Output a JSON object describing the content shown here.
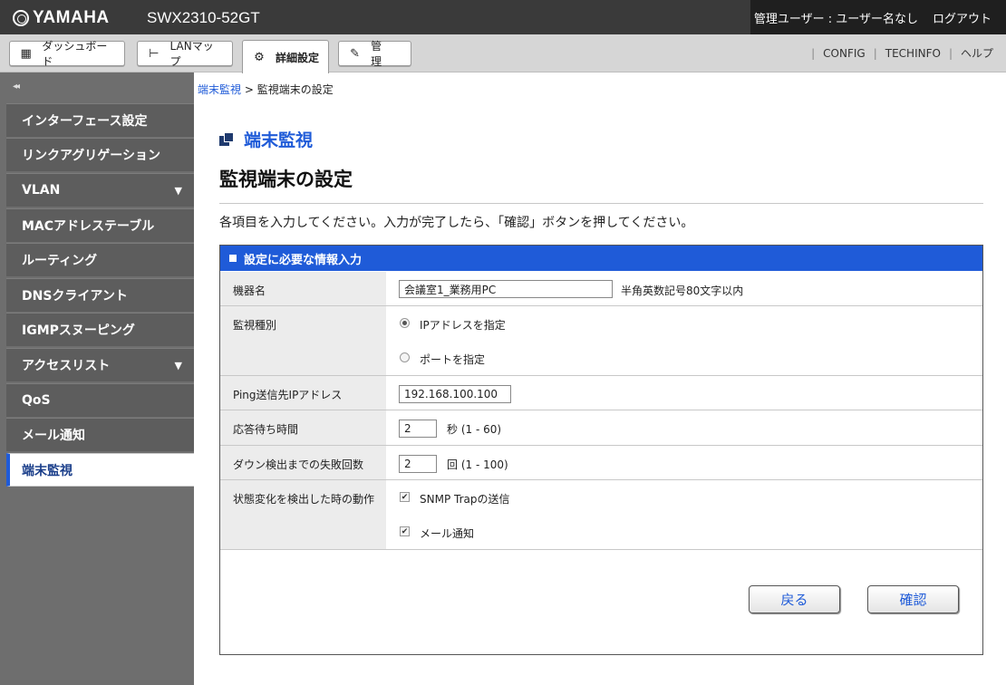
{
  "header": {
    "brand": "YAMAHA",
    "model": "SWX2310-52GT",
    "user_status": "管理ユーザー : ユーザー名なし",
    "logout": "ログアウト"
  },
  "tabs": [
    {
      "label": "ダッシュボード",
      "icon": "dashboard-icon"
    },
    {
      "label": "LANマップ",
      "icon": "lan-map-icon"
    },
    {
      "label": "詳細設定",
      "icon": "gear-icon",
      "active": true
    },
    {
      "label": "管　理",
      "icon": "wrench-icon"
    }
  ],
  "toplinks": [
    "CONFIG",
    "TECHINFO",
    "ヘルプ"
  ],
  "sidebar": {
    "collapse": "◂◂",
    "items": [
      {
        "label": "インターフェース設定"
      },
      {
        "label": "リンクアグリゲーション"
      },
      {
        "label": "VLAN",
        "arrow": "▼"
      },
      {
        "label": "MACアドレステーブル"
      },
      {
        "label": "ルーティング"
      },
      {
        "label": "DNSクライアント"
      },
      {
        "label": "IGMPスヌーピング"
      },
      {
        "label": "アクセスリスト",
        "arrow": "▼"
      },
      {
        "label": "QoS"
      },
      {
        "label": "メール通知"
      },
      {
        "label": "端末監視",
        "active": true
      }
    ]
  },
  "breadcrumb": {
    "link": "端末監視",
    "separator": " > ",
    "current": "監視端末の設定"
  },
  "section_title": "端末監視",
  "page_title": "監視端末の設定",
  "instruction": "各項目を入力してください。入力が完了したら、「確認」ボタンを押してください。",
  "form": {
    "header": "設定に必要な情報入力",
    "device_name": {
      "label": "機器名",
      "value": "会議室1_業務用PC",
      "hint": "半角英数記号80文字以内"
    },
    "monitor_type": {
      "label": "監視種別",
      "option_ip": "IPアドレスを指定",
      "option_port": "ポートを指定",
      "selected": "IPアドレスを指定"
    },
    "ping_ip": {
      "label": "Ping送信先IPアドレス",
      "value": "192.168.100.100"
    },
    "timeout": {
      "label": "応答待ち時間",
      "value": "2",
      "unit": "秒 (1 - 60)"
    },
    "fail_count": {
      "label": "ダウン検出までの失敗回数",
      "value": "2",
      "unit": "回 (1 - 100)"
    },
    "action": {
      "label": "状態変化を検出した時の動作",
      "option_snmp": "SNMP Trapの送信",
      "option_mail": "メール通知",
      "snmp_checked": true,
      "mail_checked": true
    }
  },
  "buttons": {
    "back": "戻る",
    "confirm": "確認"
  },
  "colors": {
    "accent": "#1f5bd8",
    "topbar": "#3a3a3a",
    "sidebar": "#6e6e6e"
  }
}
